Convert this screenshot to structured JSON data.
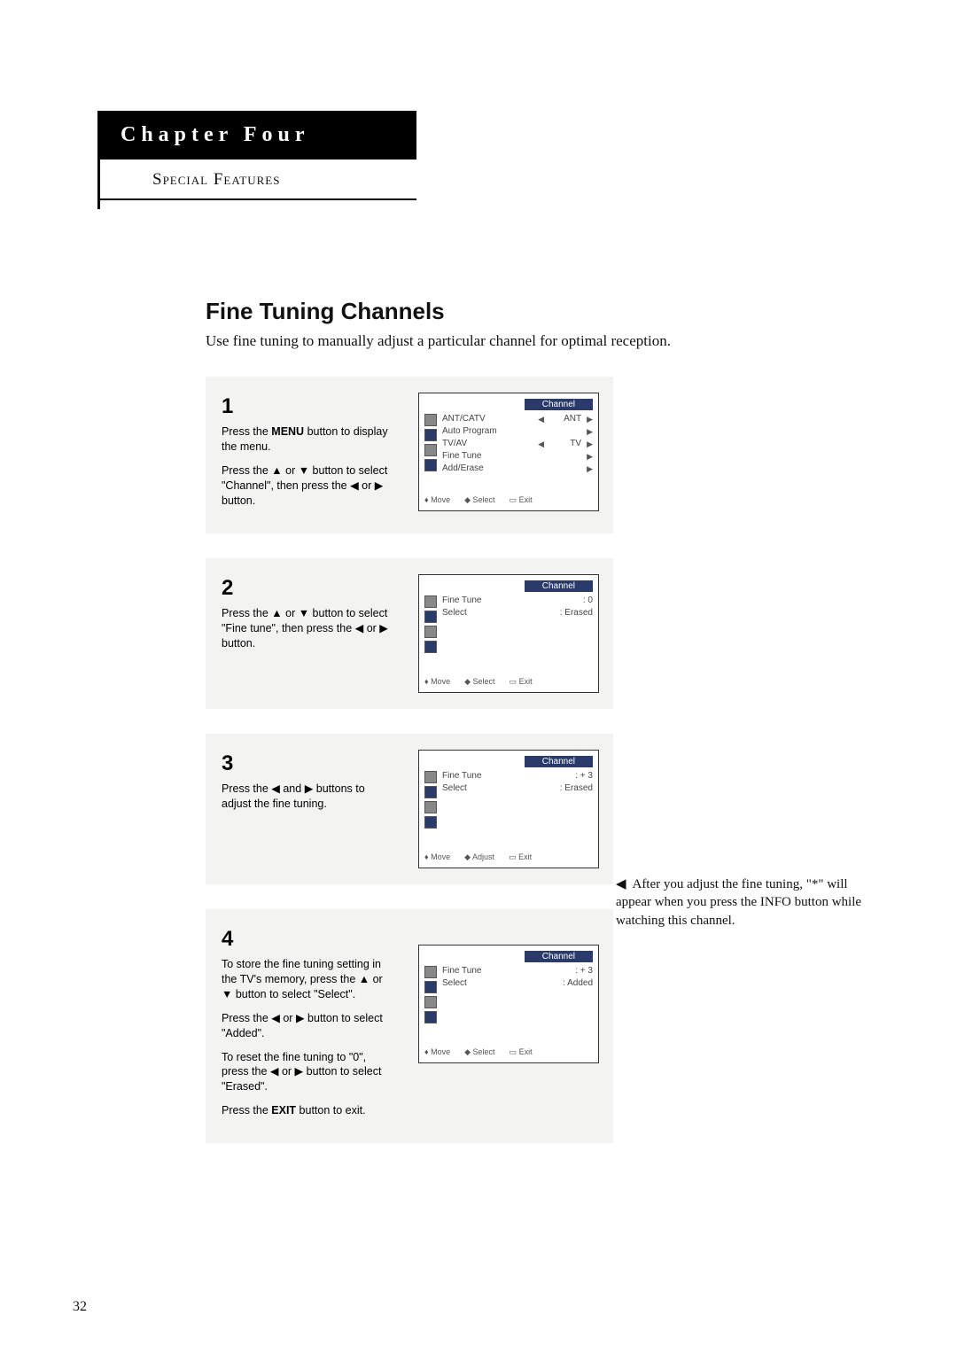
{
  "chapter": {
    "title": "Chapter Four",
    "subtitle": "Special Features"
  },
  "section": {
    "title": "Fine Tuning Channels",
    "intro": "Use fine tuning to manually adjust a particular channel for optimal reception."
  },
  "steps": [
    {
      "num": "1",
      "para1_pre": "Press the ",
      "para1_bold": "MENU",
      "para1_post": " button to display the menu.",
      "para2": "Press the ▲ or ▼ button to select \"Channel\", then press the ◀ or ▶ button.",
      "osd": {
        "title": "Channel",
        "rows": [
          {
            "label": "ANT/CATV",
            "left": "◀",
            "val": "ANT",
            "right": "▶"
          },
          {
            "label": "Auto Program",
            "left": "",
            "val": "",
            "right": "▶"
          },
          {
            "label": "TV/AV",
            "left": "◀",
            "val": "TV",
            "right": "▶"
          },
          {
            "label": "Fine Tune",
            "left": "",
            "val": "",
            "right": "▶"
          },
          {
            "label": "Add/Erase",
            "left": "",
            "val": "",
            "right": "▶"
          }
        ],
        "footer": [
          "Move",
          "Select",
          "Exit"
        ],
        "footer_mid": "Select"
      }
    },
    {
      "num": "2",
      "para1": "Press the ▲ or ▼ button to select \"Fine tune\", then press the ◀ or ▶ button.",
      "osd": {
        "title": "Channel",
        "rows": [
          {
            "label": "Fine Tune",
            "left": "",
            "val": ":       0",
            "right": ""
          },
          {
            "label": "Select",
            "left": "",
            "val": ":  Erased",
            "right": ""
          }
        ],
        "footer": [
          "Move",
          "Select",
          "Exit"
        ],
        "footer_mid": "Select"
      }
    },
    {
      "num": "3",
      "para1": "Press the ◀ and ▶ buttons to adjust the fine tuning.",
      "osd": {
        "title": "Channel",
        "rows": [
          {
            "label": "Fine Tune",
            "left": "",
            "val": ":  +   3",
            "right": ""
          },
          {
            "label": "Select",
            "left": "",
            "val": ":  Erased",
            "right": ""
          }
        ],
        "footer": [
          "Move",
          "Adjust",
          "Exit"
        ],
        "footer_mid": "Adjust"
      }
    },
    {
      "num": "4",
      "para1": "To store the fine tuning setting in the TV's memory, press the ▲ or ▼ button to select \"Select\".",
      "para2": "Press the ◀ or ▶ button to select \"Added\".",
      "para3": "To reset the fine tuning to \"0\", press the ◀ or ▶ button to select \"Erased\".",
      "para4_pre": "Press the ",
      "para4_bold": "EXIT",
      "para4_post": " button to exit.",
      "osd": {
        "title": "Channel",
        "rows": [
          {
            "label": "Fine Tune",
            "left": "",
            "val": ":  +   3",
            "right": ""
          },
          {
            "label": "Select",
            "left": "",
            "val": ":  Added",
            "right": ""
          }
        ],
        "footer": [
          "Move",
          "Select",
          "Exit"
        ],
        "footer_mid": "Select"
      }
    }
  ],
  "side_note": "After you adjust the fine tuning, \"*\" will appear when you press the INFO button while watching this channel.",
  "page_number": "32"
}
